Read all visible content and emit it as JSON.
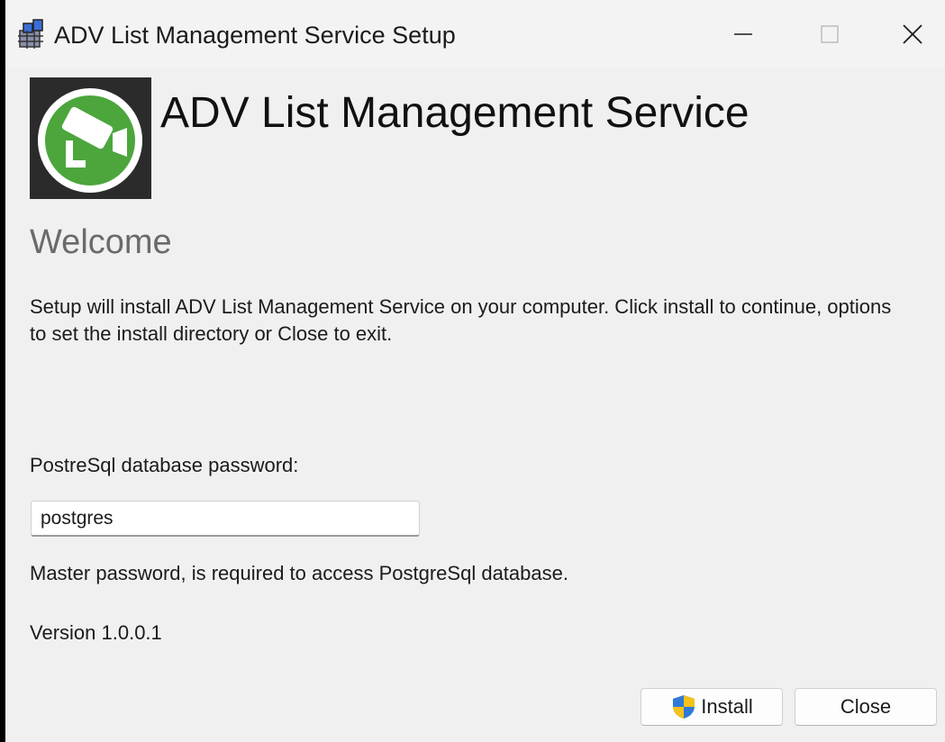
{
  "window": {
    "title": "ADV List Management Service Setup",
    "controls": {
      "minimize": "minimize",
      "maximize": "maximize",
      "close": "close"
    }
  },
  "header": {
    "product_name": "ADV List Management Service",
    "logo_icon": "security-camera-icon"
  },
  "page": {
    "heading": "Welcome",
    "description": "Setup will install ADV List Management Service on your computer. Click install to continue, options to set the install directory or Close to exit."
  },
  "password": {
    "label": "PostreSql database password:",
    "value": "postgres",
    "hint": "Master password, is required to access PostgreSql database."
  },
  "version": "Version 1.0.0.1",
  "buttons": {
    "install": "Install",
    "close": "Close"
  },
  "colors": {
    "logo_green": "#4ca63c",
    "logo_bg": "#2b2b2b",
    "heading_gray": "#6a6a6a"
  }
}
